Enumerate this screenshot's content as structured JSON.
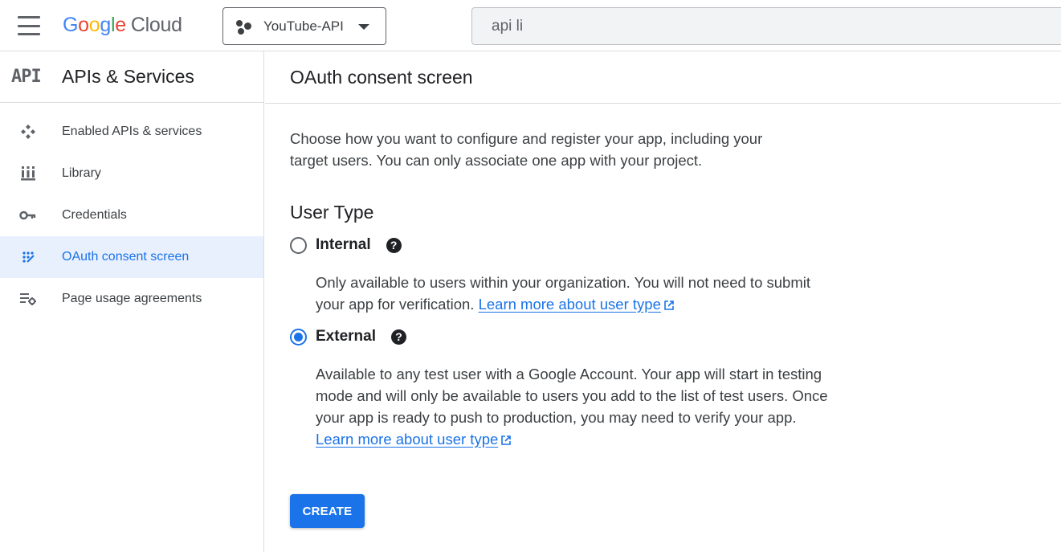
{
  "header": {
    "logo_letters": [
      "G",
      "o",
      "o",
      "g",
      "l",
      "e"
    ],
    "logo_product": "Cloud",
    "project_name": "YouTube-API",
    "search_value": "api li"
  },
  "sidebar": {
    "badge": "API",
    "title": "APIs & Services",
    "items": [
      {
        "label": "Enabled APIs & services",
        "icon": "enabled-apis-icon"
      },
      {
        "label": "Library",
        "icon": "library-icon"
      },
      {
        "label": "Credentials",
        "icon": "key-icon"
      },
      {
        "label": "OAuth consent screen",
        "icon": "oauth-icon",
        "active": true
      },
      {
        "label": "Page usage agreements",
        "icon": "settings-list-icon"
      }
    ]
  },
  "main": {
    "title": "OAuth consent screen",
    "intro": "Choose how you want to configure and register your app, including your target users. You can only associate one app with your project.",
    "user_type_heading": "User Type",
    "options": [
      {
        "label": "Internal",
        "checked": false,
        "description": "Only available to users within your organization. You will not need to submit your app for verification.",
        "link": "Learn more about user type"
      },
      {
        "label": "External",
        "checked": true,
        "description": "Available to any test user with a Google Account. Your app will start in testing mode and will only be available to users you add to the list of test users. Once your app is ready to push to production, you may need to verify your app.",
        "link": "Learn more about user type"
      }
    ],
    "help_glyph": "?",
    "create_label": "CREATE"
  },
  "colors": {
    "accent": "#1a73e8",
    "active_bg": "#e8f0fe",
    "google_blue": "#4285f4",
    "google_red": "#ea4335",
    "google_yellow": "#fbbc05",
    "google_green": "#34a853"
  }
}
